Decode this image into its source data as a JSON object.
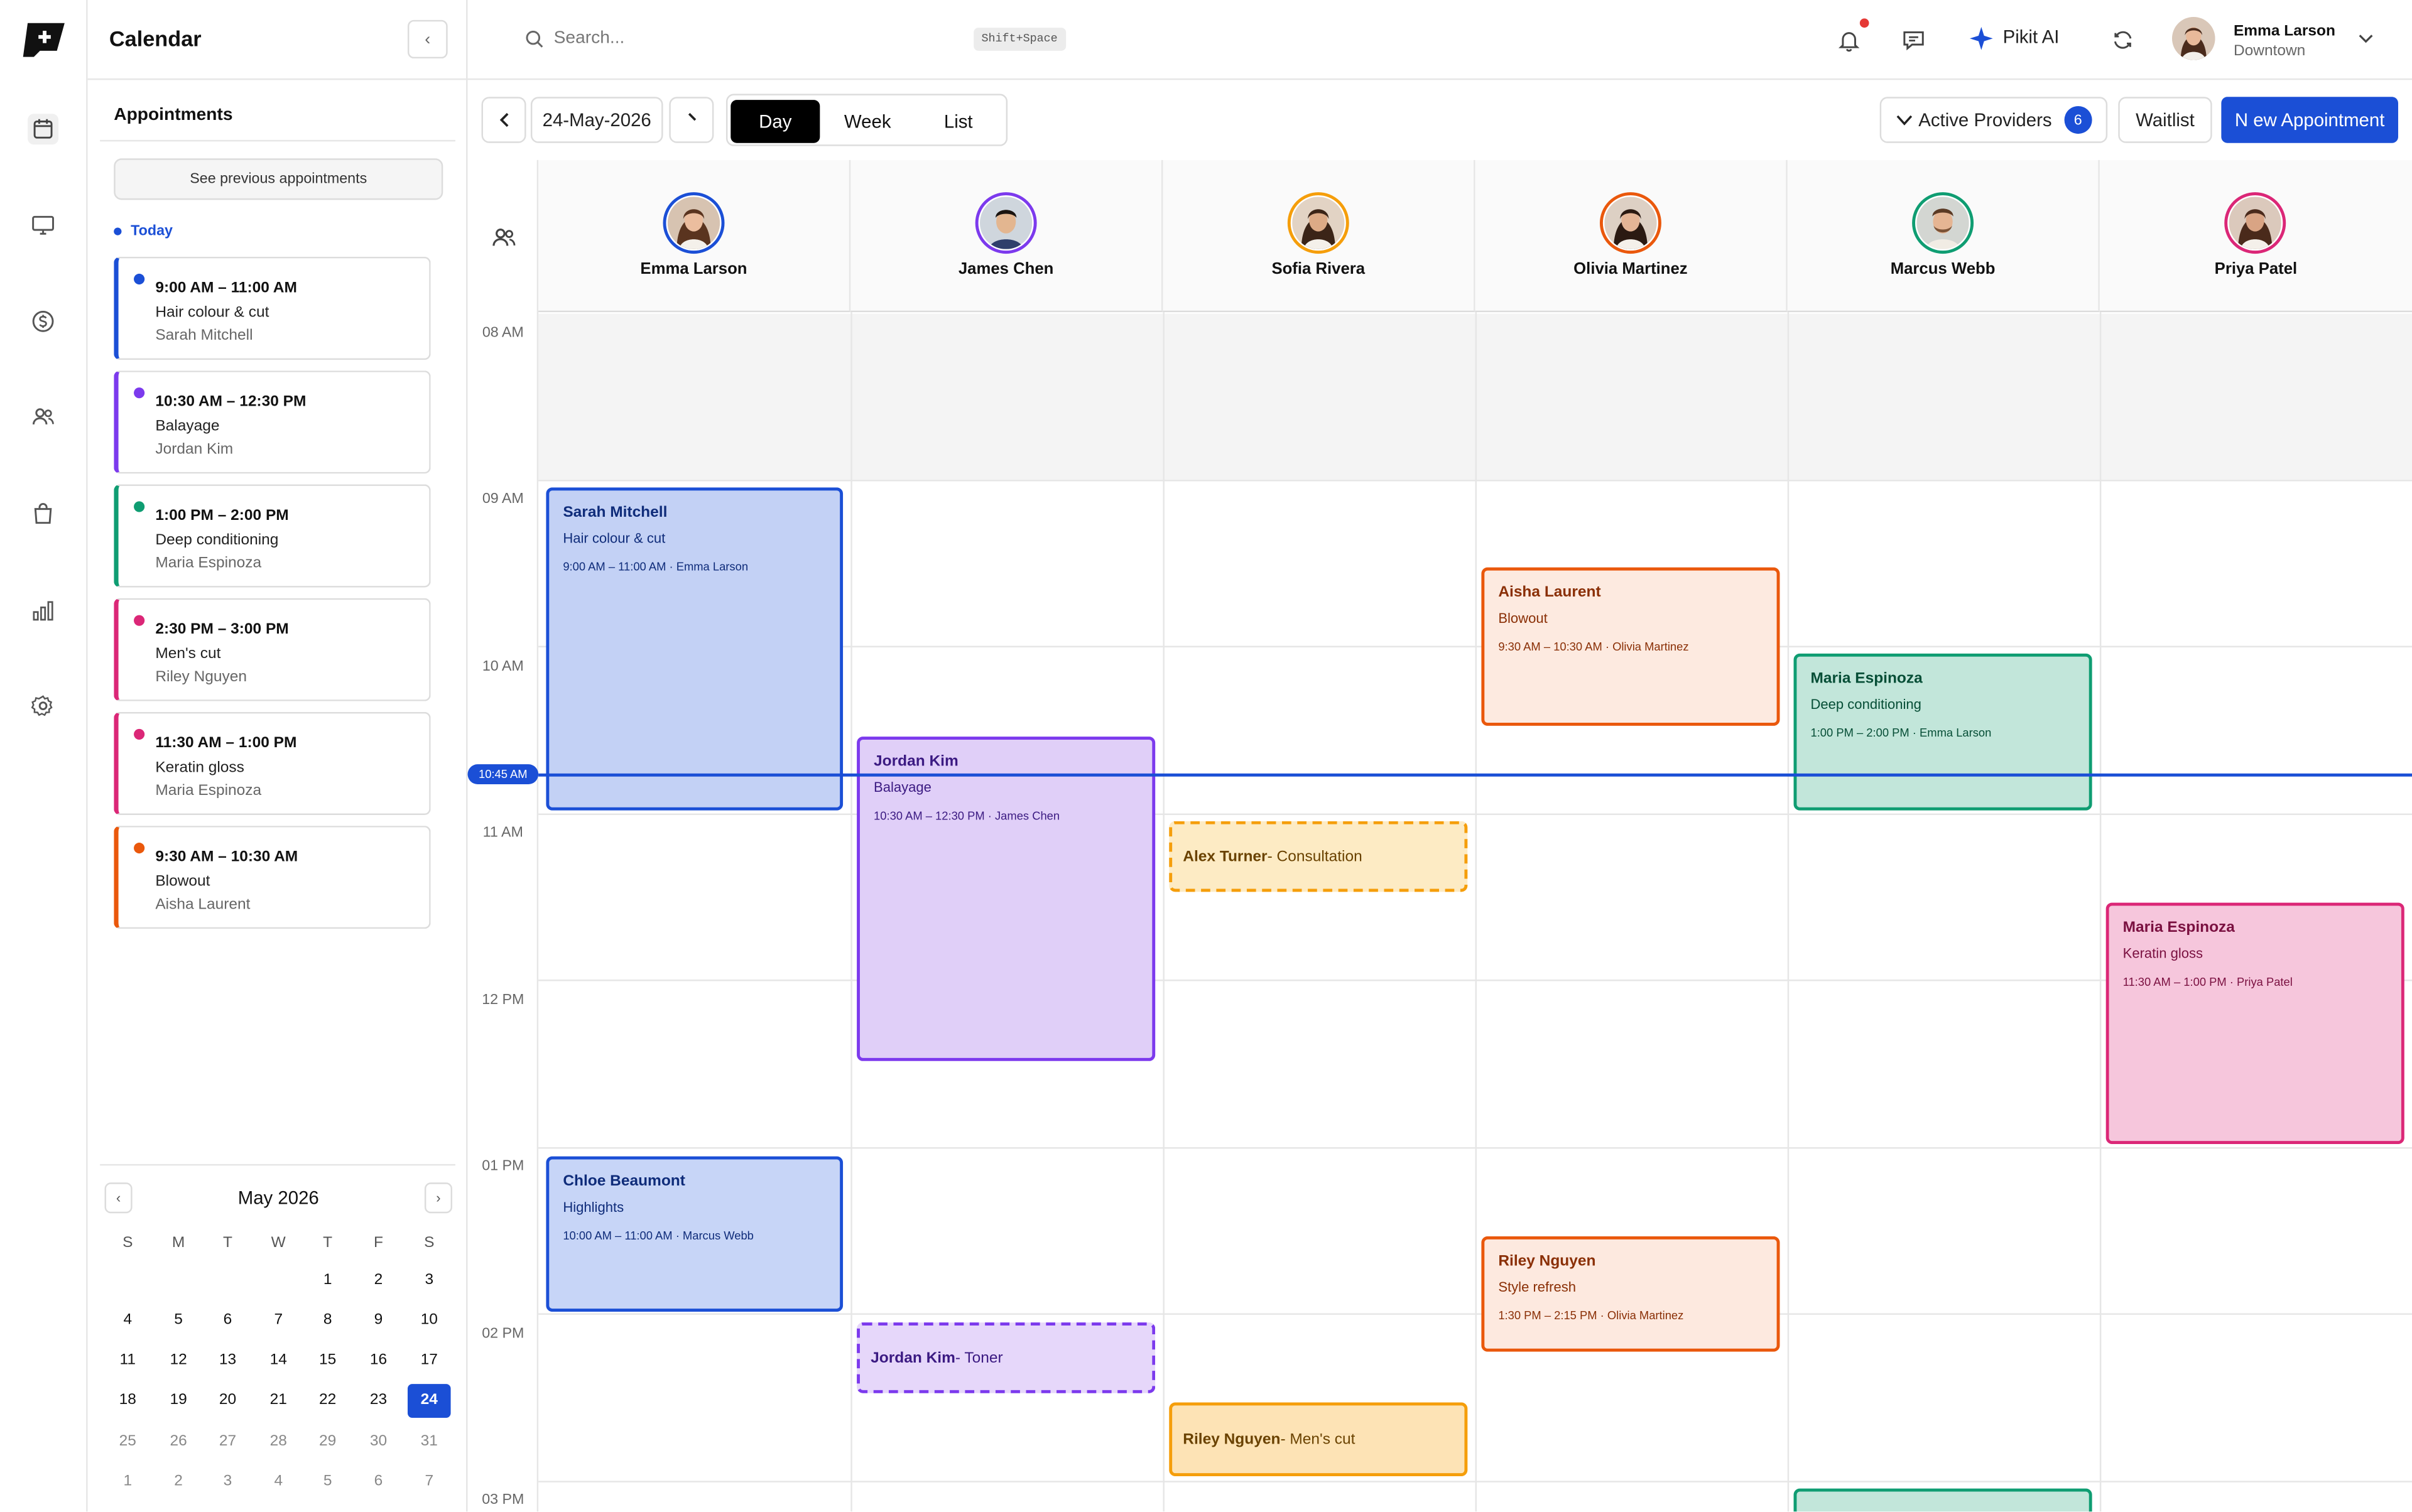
{
  "sidebar": {
    "title": "Calendar",
    "collapse": "‹",
    "appointments_heading": "Appointments",
    "see_previous": "See previous appointments",
    "today_label": "Today",
    "appointments": [
      {
        "time": "9:00 AM – 11:00 AM",
        "service": "Hair colour & cut",
        "client": "Sarah Mitchell",
        "color": "#1b4fd6"
      },
      {
        "time": "10:30 AM – 12:30 PM",
        "service": "Balayage",
        "client": "Jordan Kim",
        "color": "#7c3aed"
      },
      {
        "time": "1:00 PM – 2:00 PM",
        "service": "Deep conditioning",
        "client": "Maria Espinoza",
        "color": "#0f9d72"
      },
      {
        "time": "2:30 PM – 3:00 PM",
        "service": "Men's cut",
        "client": "Riley Nguyen",
        "color": "#db2777"
      },
      {
        "time": "11:30 AM – 1:00 PM",
        "service": "Keratin gloss",
        "client": "Maria Espinoza",
        "color": "#db2777"
      },
      {
        "time": "9:30 AM – 10:30 AM",
        "service": "Blowout",
        "client": "Aisha Laurent",
        "color": "#ea580c"
      }
    ],
    "mini_calendar": {
      "title": "May 2026",
      "prev": "‹",
      "next": "›",
      "weekdays": [
        "S",
        "M",
        "T",
        "W",
        "T",
        "F",
        "S"
      ],
      "weeks": [
        [
          "",
          "",
          "",
          "",
          "1",
          "2",
          "3"
        ],
        [
          "4",
          "5",
          "6",
          "7",
          "8",
          "9",
          "10"
        ],
        [
          "11",
          "12",
          "13",
          "14",
          "15",
          "16",
          "17"
        ],
        [
          "18",
          "19",
          "20",
          "21",
          "22",
          "23",
          "24"
        ],
        [
          "25",
          "26",
          "27",
          "28",
          "29",
          "30",
          "31"
        ],
        [
          "1",
          "2",
          "3",
          "4",
          "5",
          "6",
          "7"
        ]
      ],
      "selected": "24"
    }
  },
  "topbar": {
    "search_placeholder": "Search...",
    "shortcut": "Shift+Space",
    "ai_label": "Pikit AI",
    "user_name": "Emma Larson",
    "user_location": "Downtown"
  },
  "toolbar": {
    "date": "24-May-2026",
    "views": [
      "Day",
      "Week",
      "List"
    ],
    "active_view": "Day",
    "active_providers": "Active Providers",
    "providers_count": "6",
    "waitlist": "Waitlist",
    "new_appointment": "N ew Appointment"
  },
  "providers": [
    {
      "name": "Emma Larson",
      "ring": "#1b4fd6"
    },
    {
      "name": "James Chen",
      "ring": "#7c3aed"
    },
    {
      "name": "Sofia Rivera",
      "ring": "#f59e0b"
    },
    {
      "name": "Olivia Martinez",
      "ring": "#ea580c"
    },
    {
      "name": "Marcus Webb",
      "ring": "#0f9d72"
    },
    {
      "name": "Priya Patel",
      "ring": "#db2777"
    }
  ],
  "hours": [
    "08 AM",
    "09 AM",
    "10 AM",
    "11 AM",
    "12 PM",
    "01 PM",
    "02 PM",
    "03 PM"
  ],
  "now_label": "10:45 AM",
  "events": {
    "e1": {
      "name": "Sarah Mitchell",
      "service": "Hair colour & cut",
      "detail": "9:00 AM – 11:00 AM · Emma Larson"
    },
    "e2": {
      "name": "Chloe Beaumont",
      "service": "Highlights",
      "detail": "10:00 AM – 11:00 AM · Marcus Webb"
    },
    "e3": {
      "name": "Jordan Kim",
      "service": "Balayage",
      "detail": "10:30 AM – 12:30 PM · James Chen"
    },
    "e4": {
      "name": "Jordan Kim",
      "service": "- Toner"
    },
    "e5": {
      "name": "Alex Turner",
      "service": "- Consultation"
    },
    "e6": {
      "name": "Riley Nguyen",
      "service": "- Men's cut"
    },
    "e7": {
      "name": "Aisha Laurent",
      "service": "Blowout",
      "detail": "9:30 AM – 10:30 AM · Olivia Martinez"
    },
    "e8": {
      "name": "Riley Nguyen",
      "service": "Style refresh",
      "detail": "1:30 PM – 2:15 PM · Olivia Martinez"
    },
    "e9": {
      "name": "Maria Espinoza",
      "service": "Deep conditioning",
      "detail": "1:00 PM – 2:00 PM · Emma Larson"
    },
    "e10": {
      "name": "Maria Espinoza",
      "service": "Keratin gloss",
      "detail": "11:30 AM – 1:00 PM · Priya Patel"
    }
  }
}
